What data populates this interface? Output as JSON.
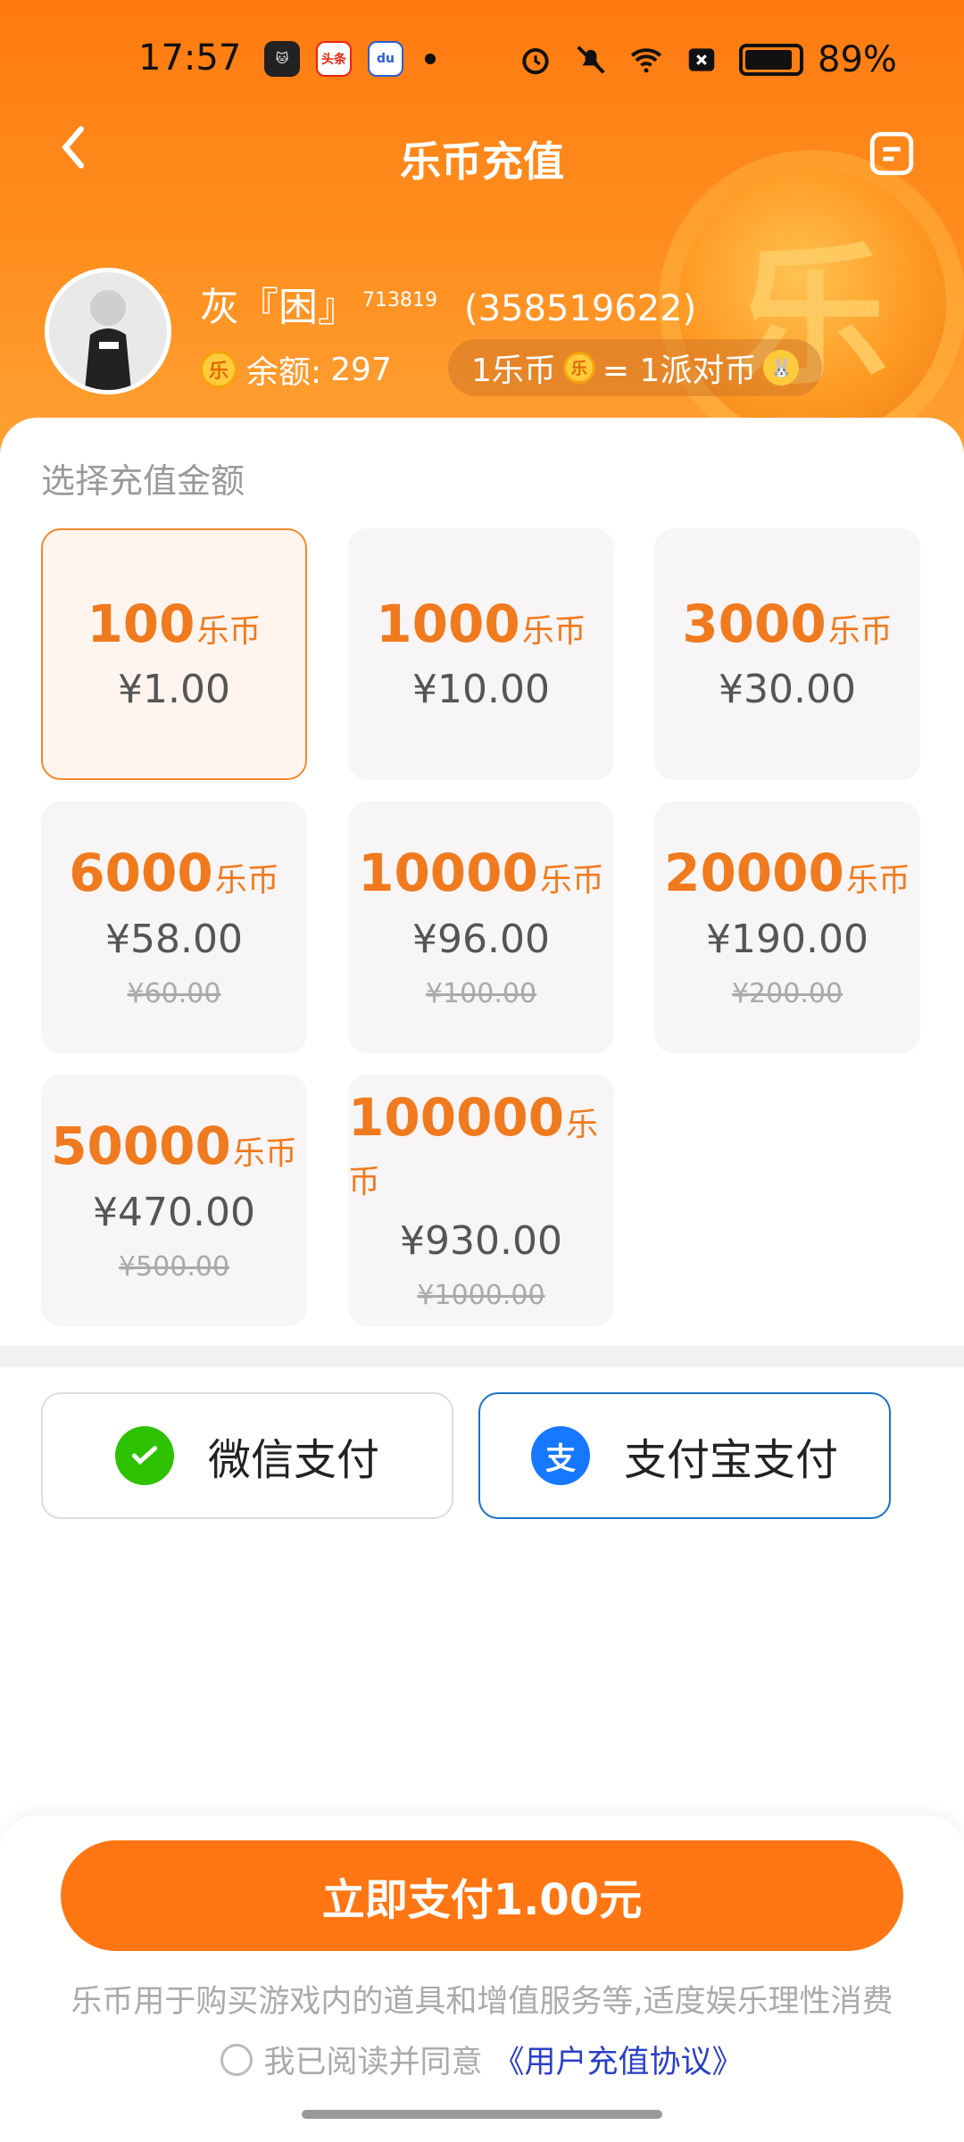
{
  "status_bar": {
    "time": "17:57",
    "app_icons": [
      "cat-app-icon",
      "toutiao-app-icon",
      "baidu-app-icon"
    ],
    "toutiao_label": "头条",
    "baidu_label": "du",
    "battery_pct": "89%"
  },
  "header": {
    "title": "乐币充值",
    "deco_char": "乐"
  },
  "user": {
    "name": "灰『困』",
    "level": "713819",
    "id": "(358519622)",
    "balance_label": "余额:",
    "balance_value": "297",
    "coin_char": "乐",
    "rate_left": "1乐币",
    "rate_right": "= 1派对币"
  },
  "recharge": {
    "section_label": "选择充值金额",
    "unit": "乐币",
    "packages": [
      {
        "coins": "100",
        "price": "¥1.00",
        "old": "",
        "selected": true
      },
      {
        "coins": "1000",
        "price": "¥10.00",
        "old": ""
      },
      {
        "coins": "3000",
        "price": "¥30.00",
        "old": ""
      },
      {
        "coins": "6000",
        "price": "¥58.00",
        "old": "¥60.00"
      },
      {
        "coins": "10000",
        "price": "¥96.00",
        "old": "¥100.00"
      },
      {
        "coins": "20000",
        "price": "¥190.00",
        "old": "¥200.00"
      },
      {
        "coins": "50000",
        "price": "¥470.00",
        "old": "¥500.00"
      },
      {
        "coins": "100000",
        "price": "¥930.00",
        "old": "¥1000.00"
      }
    ]
  },
  "payment": {
    "wechat": "微信支付",
    "alipay": "支付宝支付",
    "alipay_icon_char": "支",
    "selected": "alipay"
  },
  "footer": {
    "pay_button": "立即支付1.00元",
    "note": "乐币用于购买游戏内的道具和增值服务等,适度娱乐理性消费",
    "agree_text": "我已阅读并同意",
    "agree_link": "《用户充值协议》"
  },
  "colors": {
    "brand_orange": "#ff7612",
    "coin_text": "#f07a1e",
    "alipay_blue": "#1a72c5",
    "wechat_green": "#2dc100"
  }
}
